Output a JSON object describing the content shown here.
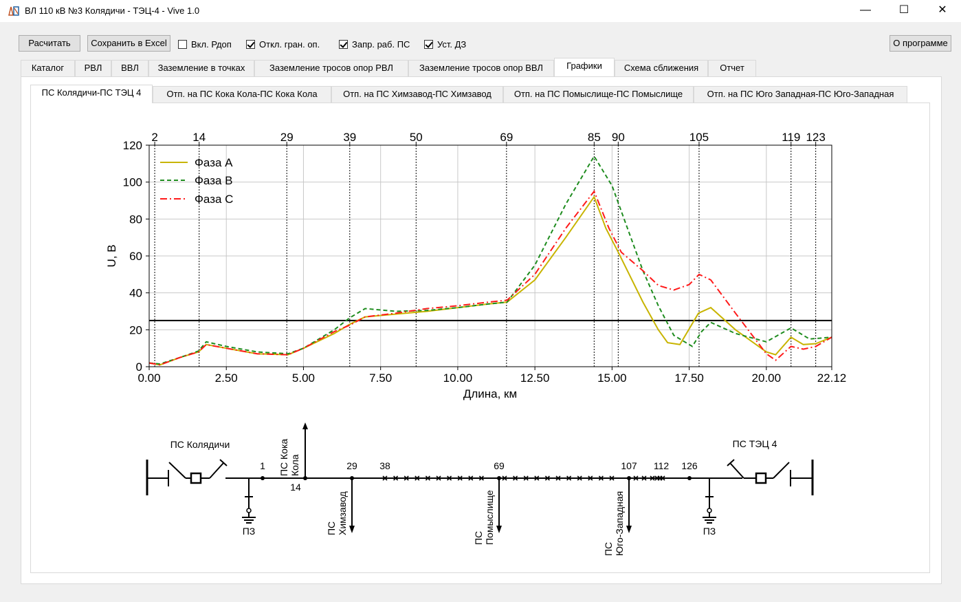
{
  "window": {
    "title": "ВЛ 110 кВ №3 Колядичи - ТЭЦ-4 - Vive 1.0",
    "minimize_glyph": "—",
    "maximize_glyph": "☐",
    "close_glyph": "✕"
  },
  "toolbar": {
    "calc_label": "Расчитать",
    "save_excel_label": "Сохранить в Excel",
    "checkboxes": [
      {
        "label": "Вкл. Рдоп",
        "checked": false
      },
      {
        "label": "Откл. гран. оп.",
        "checked": true
      },
      {
        "label": "Запр. раб. ПС",
        "checked": true
      },
      {
        "label": "Уст. ДЗ",
        "checked": true
      }
    ],
    "about_label": "О программе"
  },
  "main_tabs": [
    {
      "label": "Каталог",
      "active": false
    },
    {
      "label": "РВЛ",
      "active": false
    },
    {
      "label": "ВВЛ",
      "active": false
    },
    {
      "label": "Заземление в точках",
      "active": false
    },
    {
      "label": "Заземление тросов опор РВЛ",
      "active": false
    },
    {
      "label": "Заземление тросов опор ВВЛ",
      "active": false
    },
    {
      "label": "Графики",
      "active": true
    },
    {
      "label": "Схема сближения",
      "active": false
    },
    {
      "label": "Отчет",
      "active": false
    }
  ],
  "sub_tabs": [
    {
      "label": "ПС Колядичи-ПС ТЭЦ 4",
      "active": true
    },
    {
      "label": "Отп. на ПС Кока Кола-ПС Кока Кола",
      "active": false
    },
    {
      "label": "Отп. на ПС Химзавод-ПС Химзавод",
      "active": false
    },
    {
      "label": "Отп. на ПС Помыслище-ПС Помыслище",
      "active": false
    },
    {
      "label": "Отп. на ПС Юго Западная-ПС Юго-Западная",
      "active": false
    }
  ],
  "chart_data": {
    "type": "line",
    "xlabel": "Длина, км",
    "ylabel": "U, В",
    "xlim": [
      0,
      22.12
    ],
    "ylim": [
      0,
      120
    ],
    "x_ticks": [
      "0.00",
      "2.50",
      "5.00",
      "7.50",
      "10.00",
      "12.50",
      "15.00",
      "17.50",
      "20.00",
      "22.12"
    ],
    "x_tick_values": [
      0,
      2.5,
      5,
      7.5,
      10,
      12.5,
      15,
      17.5,
      20,
      22.12
    ],
    "y_ticks": [
      0,
      20,
      40,
      60,
      80,
      100,
      120
    ],
    "grid": true,
    "legend_position": "top-left",
    "threshold_line": 25,
    "pole_markers": [
      {
        "label": "2",
        "x": 0.18
      },
      {
        "label": "14",
        "x": 1.62
      },
      {
        "label": "29",
        "x": 4.46
      },
      {
        "label": "39",
        "x": 6.5
      },
      {
        "label": "50",
        "x": 8.65
      },
      {
        "label": "69",
        "x": 11.58
      },
      {
        "label": "85",
        "x": 14.42
      },
      {
        "label": "90",
        "x": 15.2
      },
      {
        "label": "105",
        "x": 17.82
      },
      {
        "label": "119",
        "x": 20.8
      },
      {
        "label": "123",
        "x": 21.6
      }
    ],
    "series": [
      {
        "name": "Фаза A",
        "color": "#c8b400",
        "dash": "solid",
        "x": [
          0,
          0.35,
          1,
          1.6,
          1.85,
          2.5,
          3.5,
          4.5,
          5,
          6,
          6.5,
          7,
          8,
          9,
          10,
          11,
          11.6,
          12.5,
          13.5,
          14.42,
          14.8,
          15.2,
          16,
          16.5,
          16.8,
          17.2,
          17.8,
          18.2,
          19,
          20,
          20.3,
          20.8,
          21.2,
          21.6,
          22.12
        ],
        "y": [
          2,
          1,
          5,
          8,
          12,
          10,
          7,
          6.5,
          10,
          18,
          23,
          27,
          28.5,
          30,
          32,
          34,
          35,
          47,
          70,
          92,
          75,
          62,
          35,
          20,
          13,
          12,
          29,
          32,
          20,
          8,
          6.5,
          16,
          12,
          12.5,
          16
        ]
      },
      {
        "name": "Фаза B",
        "color": "#1e8c1e",
        "dash": "dashed",
        "x": [
          0,
          0.35,
          1,
          1.6,
          1.85,
          2.5,
          3.5,
          4.5,
          5,
          6,
          6.5,
          7,
          8,
          9,
          10,
          11,
          11.6,
          12.5,
          13.5,
          14.42,
          15,
          15.5,
          16,
          16.5,
          17,
          17.6,
          17.9,
          18.2,
          19,
          20,
          20.8,
          21.4,
          22.12
        ],
        "y": [
          2,
          1.5,
          5,
          8.5,
          13.5,
          11,
          8,
          7,
          10,
          20,
          26.5,
          31.5,
          30,
          30.5,
          32,
          34,
          35,
          55,
          88,
          114,
          98,
          75,
          52,
          33,
          17,
          11,
          19,
          24,
          18,
          13.5,
          21,
          15,
          16
        ]
      },
      {
        "name": "Фаза C",
        "color": "#ff1a1a",
        "dash": "dashdot",
        "x": [
          0,
          0.35,
          1,
          1.6,
          1.85,
          2.5,
          3.5,
          4.5,
          5,
          6,
          6.5,
          7,
          8,
          9,
          10,
          11,
          11.6,
          12.5,
          13.5,
          14.42,
          14.9,
          15.3,
          16,
          16.5,
          17,
          17.5,
          17.82,
          18.2,
          19,
          20,
          20.3,
          20.8,
          21.2,
          21.6,
          22.12
        ],
        "y": [
          2,
          1,
          5,
          8,
          12,
          10,
          7,
          6.5,
          10,
          19,
          22.5,
          27,
          29,
          31.5,
          33,
          35,
          36,
          50,
          75,
          95,
          75,
          62,
          52,
          44,
          41.5,
          44.5,
          50,
          47,
          29,
          7,
          3.5,
          11,
          9.5,
          11,
          16
        ]
      }
    ]
  },
  "schematic": {
    "left_substation": "ПС Колядичи",
    "right_substation": "ПС ТЭЦ 4",
    "ground_label": "ПЗ",
    "top_labels": [
      {
        "label": "1",
        "x": 382
      },
      {
        "label": "29",
        "x": 512
      },
      {
        "label": "38",
        "x": 560
      },
      {
        "label": "69",
        "x": 726
      },
      {
        "label": "107",
        "x": 915
      },
      {
        "label": "112",
        "x": 962
      },
      {
        "label": "126",
        "x": 1003
      }
    ],
    "below_label": "14",
    "branches": [
      {
        "line1": "ПС Кока",
        "line2": "Кола"
      },
      {
        "line1": "ПС",
        "line2": "Химзавод"
      },
      {
        "line1": "ПС",
        "line2": "Помыслище"
      },
      {
        "line1": "ПС",
        "line2": "Юго-Западная"
      }
    ]
  }
}
